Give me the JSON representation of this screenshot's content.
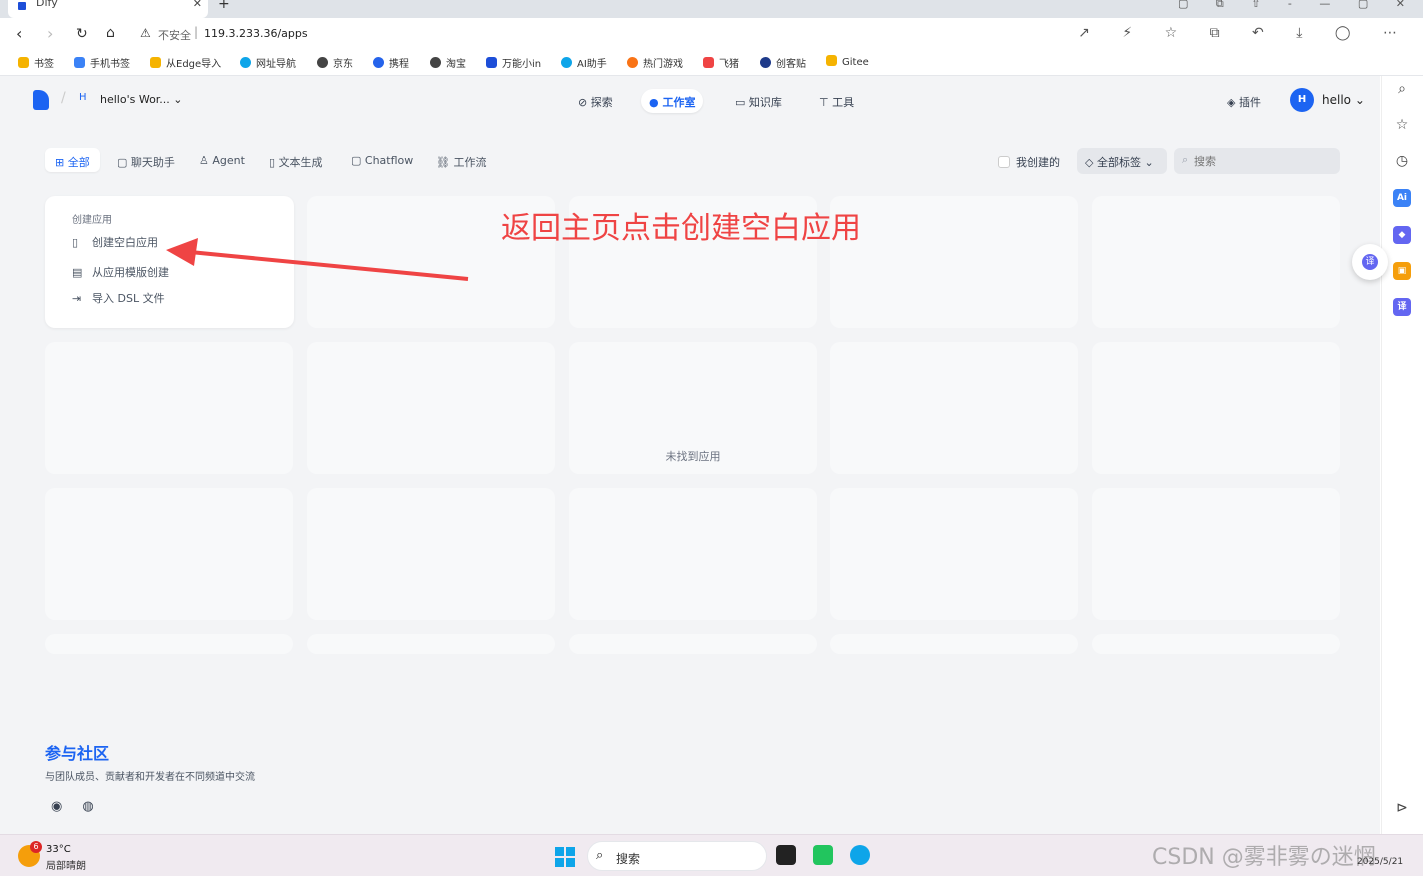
{
  "browser": {
    "tab_title": "Dify",
    "address_insecure": "不安全",
    "address_url": "119.3.233.36/apps",
    "bookmarks": [
      "书签",
      "手机书签",
      "从Edge导入",
      "网址导航",
      "京东",
      "携程",
      "淘宝",
      "万能小in",
      "AI助手",
      "热门游戏",
      "飞猪",
      "创客贴",
      "Gitee"
    ]
  },
  "app": {
    "workspace_badge": "H",
    "workspace_name": "hello's Wor...",
    "nav": [
      {
        "label": "探索",
        "icon": "compass-icon"
      },
      {
        "label": "工作室",
        "icon": "robot-icon"
      },
      {
        "label": "知识库",
        "icon": "book-icon"
      },
      {
        "label": "工具",
        "icon": "hammer-icon"
      }
    ],
    "plugin_label": "插件",
    "user_initial": "H",
    "user_name": "hello"
  },
  "filters": {
    "tabs": [
      "全部",
      "聊天助手",
      "Agent",
      "文本生成",
      "Chatflow",
      "工作流"
    ],
    "mine_label": "我创建的",
    "tags_label": "全部标签",
    "search_placeholder": "搜索"
  },
  "create_card": {
    "title": "创建应用",
    "items": [
      "创建空白应用",
      "从应用模版创建",
      "导入 DSL 文件"
    ]
  },
  "empty_text": "未找到应用",
  "annotation": "返回主页点击创建空白应用",
  "community": {
    "title": "参与社区",
    "description": "与团队成员、贡献者和开发者在不同频道中交流"
  },
  "taskbar": {
    "weather_badge": "6",
    "temperature": "33°C",
    "condition": "局部晴朗",
    "search_label": "搜索",
    "watermark": "CSDN @雾非雾の迷惘",
    "date": "2025/5/21"
  },
  "colors": {
    "accent": "#1c64f2",
    "annotation": "#ef4444"
  }
}
